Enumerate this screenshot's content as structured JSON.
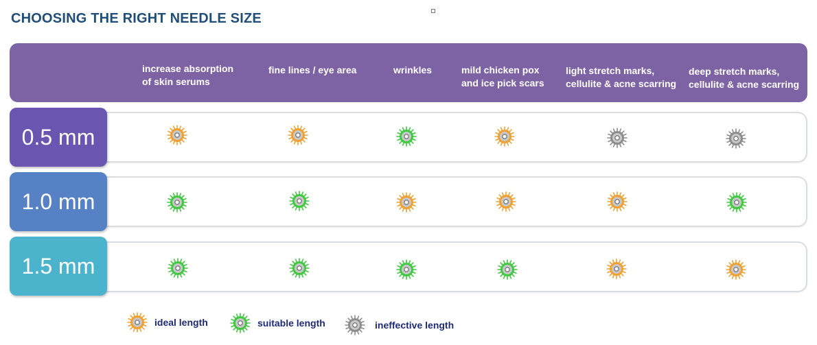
{
  "title": "CHOOSING THE RIGHT NEEDLE SIZE",
  "colors": {
    "header": "#7d62a4",
    "ideal": "#f0a030",
    "suitable": "#3ec93e",
    "ineffective": "#8c8c8c",
    "row_0_5": "#6a55b0",
    "row_1_0": "#5681c4",
    "row_1_5": "#4cb3cc"
  },
  "columns": [
    "increase absorption\nof skin serums",
    "fine lines / eye area",
    "wrinkles",
    "mild chicken pox\nand ice pick scars",
    "light stretch marks,\ncellulite & acne scarring",
    "deep stretch marks,\ncellulite & acne scarring"
  ],
  "rows": [
    {
      "label": "0.5 mm",
      "ratings": [
        "ideal",
        "ideal",
        "suitable",
        "ideal",
        "ineffective",
        "ineffective"
      ]
    },
    {
      "label": "1.0 mm",
      "ratings": [
        "suitable",
        "suitable",
        "ideal",
        "ideal",
        "ideal",
        "suitable"
      ]
    },
    {
      "label": "1.5 mm",
      "ratings": [
        "suitable",
        "suitable",
        "suitable",
        "suitable",
        "ideal",
        "ideal"
      ]
    }
  ],
  "legend": [
    {
      "type": "ideal",
      "label": "ideal length"
    },
    {
      "type": "suitable",
      "label": "suitable length"
    },
    {
      "type": "ineffective",
      "label": "ineffective length"
    }
  ]
}
